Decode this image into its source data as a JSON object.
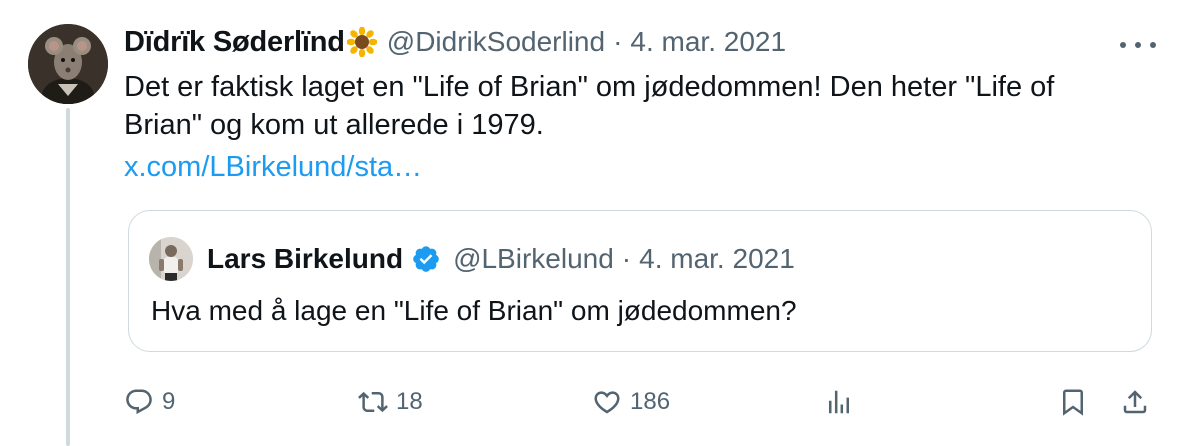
{
  "tweet": {
    "author": {
      "display_name": "Dïdrïk Søderlïnd",
      "emoji": "sunflower",
      "handle": "@DidrikSoderlind"
    },
    "separator": "·",
    "date": "4. mar. 2021",
    "text": "Det er faktisk laget en \"Life of Brian\" om jødedommen! Den heter \"Life of Brian\" og kom ut allerede i 1979.",
    "link_text": "x.com/LBirkelund/sta…",
    "more_icon": "more-horizontal-icon"
  },
  "quoted_tweet": {
    "author": {
      "display_name": "Lars Birkelund",
      "verified": true,
      "handle": "@LBirkelund"
    },
    "separator": "·",
    "date": "4. mar. 2021",
    "text": "Hva med å lage en \"Life of Brian\" om jødedommen?"
  },
  "actions": {
    "reply": {
      "icon": "reply-icon",
      "count": "9"
    },
    "retweet": {
      "icon": "retweet-icon",
      "count": "18"
    },
    "like": {
      "icon": "heart-icon",
      "count": "186"
    },
    "views": {
      "icon": "views-chart-icon"
    },
    "bookmark": {
      "icon": "bookmark-icon"
    },
    "share": {
      "icon": "share-icon"
    }
  },
  "colors": {
    "link": "#1d9bf0",
    "secondary_text": "#536471",
    "border": "#cfd9de",
    "verified": "#1d9bf0"
  }
}
